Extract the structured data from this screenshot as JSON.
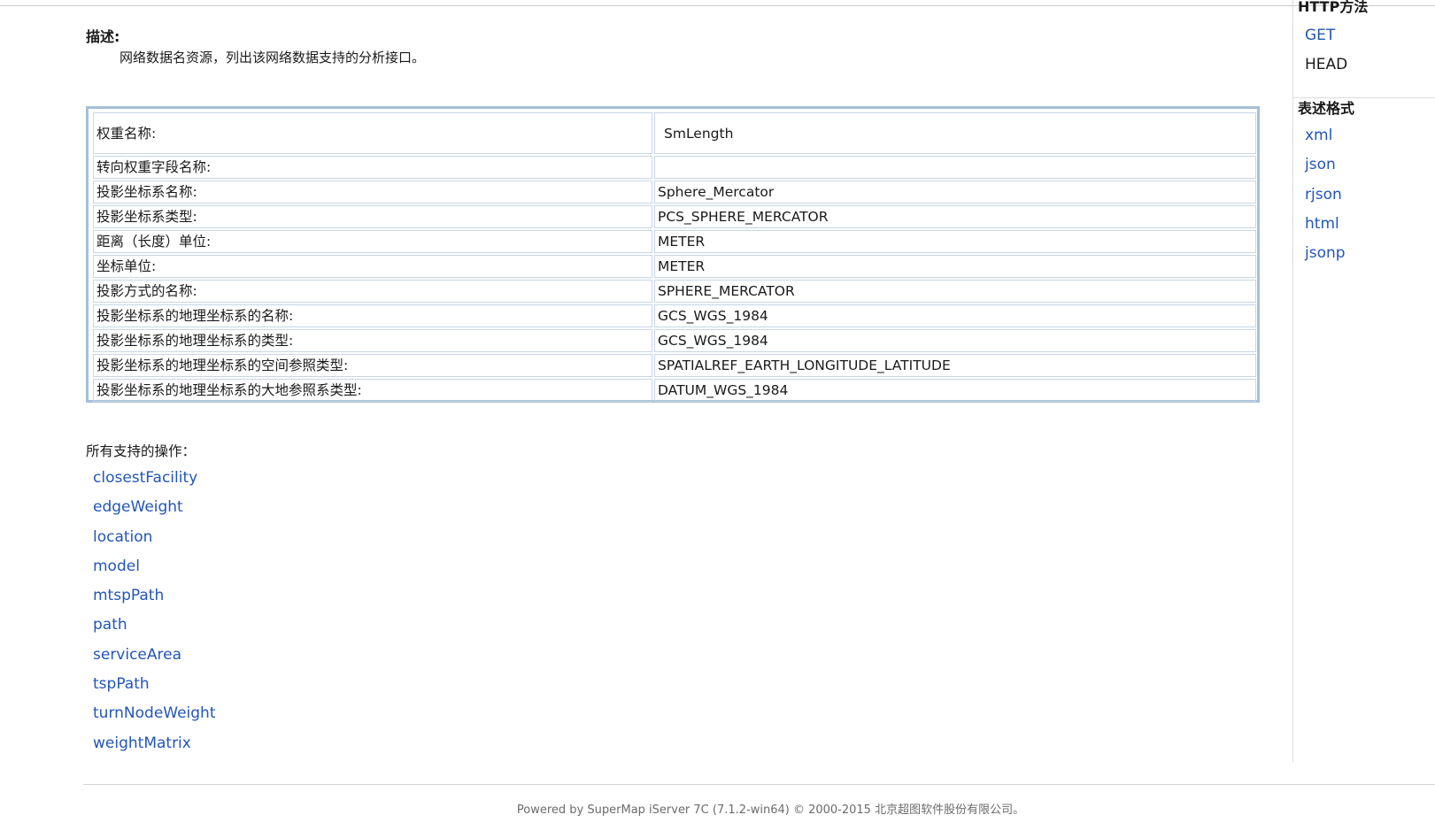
{
  "description": {
    "heading": "描述:",
    "text": "网络数据名资源，列出该网络数据支持的分析接口。"
  },
  "info_table": {
    "rows": [
      {
        "key": "权重名称:",
        "value": "SmLength"
      },
      {
        "key": "转向权重字段名称:",
        "value": ""
      },
      {
        "key": "投影坐标系名称:",
        "value": "Sphere_Mercator"
      },
      {
        "key": "投影坐标系类型:",
        "value": "PCS_SPHERE_MERCATOR"
      },
      {
        "key": "距离（长度）单位:",
        "value": "METER"
      },
      {
        "key": "坐标单位:",
        "value": "METER"
      },
      {
        "key": "投影方式的名称:",
        "value": "SPHERE_MERCATOR"
      },
      {
        "key": "投影坐标系的地理坐标系的名称:",
        "value": "GCS_WGS_1984"
      },
      {
        "key": "投影坐标系的地理坐标系的类型:",
        "value": "GCS_WGS_1984"
      },
      {
        "key": "投影坐标系的地理坐标系的空间参照类型:",
        "value": "SPATIALREF_EARTH_LONGITUDE_LATITUDE"
      },
      {
        "key": "投影坐标系的地理坐标系的大地参照系类型:",
        "value": "DATUM_WGS_1984"
      }
    ]
  },
  "operations": {
    "label": "所有支持的操作：",
    "items": [
      "closestFacility",
      "edgeWeight",
      "location",
      "model",
      "mtspPath",
      "path",
      "serviceArea",
      "tspPath",
      "turnNodeWeight",
      "weightMatrix"
    ]
  },
  "sidebar": {
    "http_heading": "HTTP方法",
    "methods": [
      {
        "label": "GET",
        "is_link": true
      },
      {
        "label": "HEAD",
        "is_link": false
      }
    ],
    "format_heading": "表述格式",
    "formats": [
      "xml",
      "json",
      "rjson",
      "html",
      "jsonp"
    ]
  },
  "footer": {
    "text": "Powered by SuperMap iServer 7C (7.1.2-win64) © 2000-2015 北京超图软件股份有限公司。"
  },
  "colors": {
    "link": "#2356b4",
    "table_border": "#a7bfd8"
  }
}
